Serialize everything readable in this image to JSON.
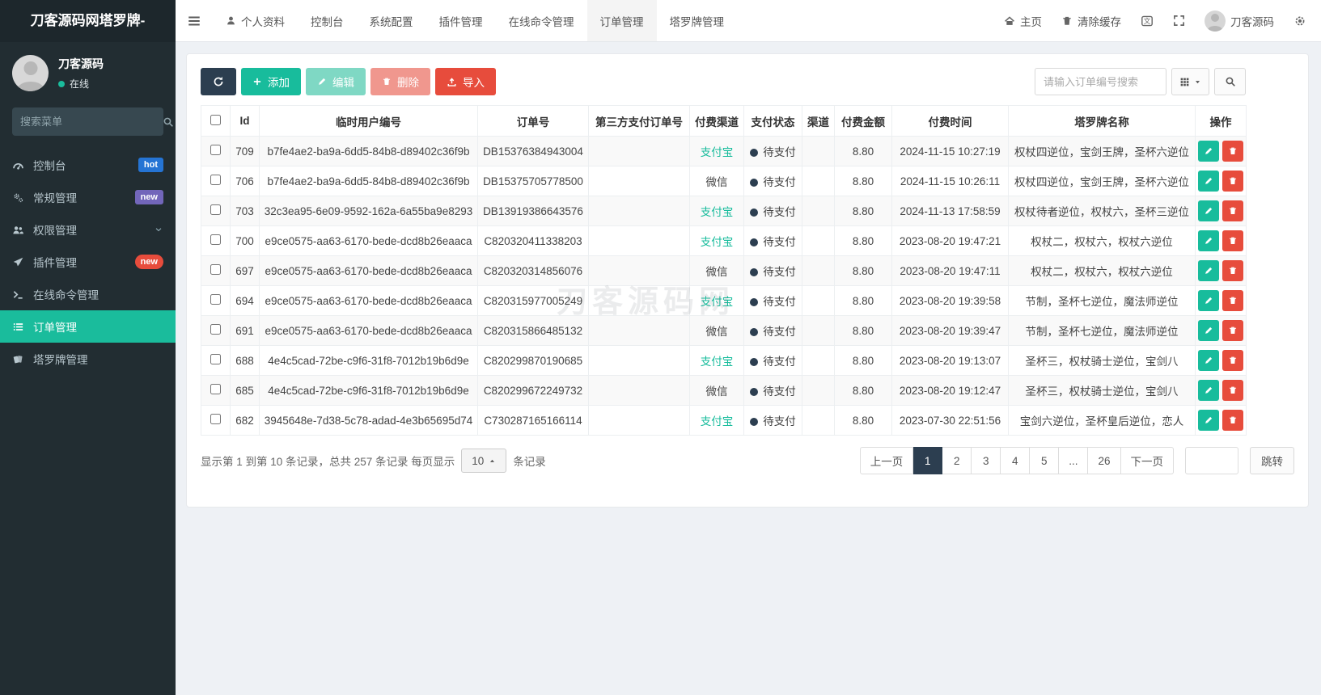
{
  "colors": {
    "accent_teal": "#1abc9c",
    "dark_navy": "#2c3e50",
    "danger_red": "#e74c3c",
    "badge_blue": "#2574d4",
    "badge_purple": "#7266ba",
    "sidebar_bg": "#222d32"
  },
  "watermark": "刀客源码网",
  "sidebar": {
    "brand": "刀客源码网塔罗牌-",
    "user": {
      "name": "刀客源码",
      "status": "在线"
    },
    "search_placeholder": "搜索菜单",
    "items": [
      {
        "key": "dashboard",
        "label": "控制台",
        "icon": "dashboard",
        "badge": "hot",
        "badge_color": "#2574d4",
        "badge_pill": false,
        "active": false,
        "chevron": false
      },
      {
        "key": "general",
        "label": "常规管理",
        "icon": "gears",
        "badge": "new",
        "badge_color": "#7266ba",
        "badge_pill": false,
        "active": false,
        "chevron": false
      },
      {
        "key": "auth",
        "label": "权限管理",
        "icon": "users",
        "badge": "",
        "active": false,
        "chevron": true
      },
      {
        "key": "addon",
        "label": "插件管理",
        "icon": "rocket",
        "badge": "new",
        "badge_color": "#e74c3c",
        "badge_pill": true,
        "active": false,
        "chevron": false
      },
      {
        "key": "command",
        "label": "在线命令管理",
        "icon": "terminal",
        "badge": "",
        "active": false,
        "chevron": false
      },
      {
        "key": "order",
        "label": "订单管理",
        "icon": "list",
        "badge": "",
        "active": true,
        "chevron": false
      },
      {
        "key": "tarot",
        "label": "塔罗牌管理",
        "icon": "cards",
        "badge": "",
        "active": false,
        "chevron": false
      }
    ]
  },
  "topbar": {
    "tabs": [
      {
        "key": "profile",
        "label": "个人资料",
        "icon": "user",
        "active": false
      },
      {
        "key": "dashboard",
        "label": "控制台",
        "icon": "",
        "active": false
      },
      {
        "key": "config",
        "label": "系统配置",
        "icon": "",
        "active": false
      },
      {
        "key": "addon",
        "label": "插件管理",
        "icon": "",
        "active": false
      },
      {
        "key": "command",
        "label": "在线命令管理",
        "icon": "",
        "active": false
      },
      {
        "key": "order",
        "label": "订单管理",
        "icon": "",
        "active": true
      },
      {
        "key": "tarot",
        "label": "塔罗牌管理",
        "icon": "",
        "active": false
      }
    ],
    "right": {
      "home": "主页",
      "clear_cache": "清除缓存",
      "username": "刀客源码"
    }
  },
  "toolbar": {
    "add": "添加",
    "edit": "编辑",
    "delete": "删除",
    "import": "导入",
    "search_placeholder": "请输入订单编号搜索"
  },
  "table": {
    "columns": [
      "Id",
      "临时用户编号",
      "订单号",
      "第三方支付订单号",
      "付费渠道",
      "支付状态",
      "渠道",
      "付费金额",
      "付费时间",
      "塔罗牌名称",
      "操作"
    ],
    "rows": [
      {
        "id": "709",
        "user_no": "b7fe4ae2-ba9a-6dd5-84b8-d89402c36f9b",
        "order_no": "DB15376384943004",
        "third_no": "",
        "channel": "支付宝",
        "channel_class": "alipay",
        "status": "待支付",
        "qudao": "",
        "amount": "8.80",
        "time": "2024-11-15 10:27:19",
        "tarot": "权杖四逆位，宝剑王牌，圣杯六逆位"
      },
      {
        "id": "706",
        "user_no": "b7fe4ae2-ba9a-6dd5-84b8-d89402c36f9b",
        "order_no": "DB15375705778500",
        "third_no": "",
        "channel": "微信",
        "channel_class": "wechat",
        "status": "待支付",
        "qudao": "",
        "amount": "8.80",
        "time": "2024-11-15 10:26:11",
        "tarot": "权杖四逆位，宝剑王牌，圣杯六逆位"
      },
      {
        "id": "703",
        "user_no": "32c3ea95-6e09-9592-162a-6a55ba9e8293",
        "order_no": "DB13919386643576",
        "third_no": "",
        "channel": "支付宝",
        "channel_class": "alipay",
        "status": "待支付",
        "qudao": "",
        "amount": "8.80",
        "time": "2024-11-13 17:58:59",
        "tarot": "权杖待者逆位，权杖六，圣杯三逆位"
      },
      {
        "id": "700",
        "user_no": "e9ce0575-aa63-6170-bede-dcd8b26eaaca",
        "order_no": "C820320411338203",
        "third_no": "",
        "channel": "支付宝",
        "channel_class": "alipay",
        "status": "待支付",
        "qudao": "",
        "amount": "8.80",
        "time": "2023-08-20 19:47:21",
        "tarot": "权杖二，权杖六，权杖六逆位"
      },
      {
        "id": "697",
        "user_no": "e9ce0575-aa63-6170-bede-dcd8b26eaaca",
        "order_no": "C820320314856076",
        "third_no": "",
        "channel": "微信",
        "channel_class": "wechat",
        "status": "待支付",
        "qudao": "",
        "amount": "8.80",
        "time": "2023-08-20 19:47:11",
        "tarot": "权杖二，权杖六，权杖六逆位"
      },
      {
        "id": "694",
        "user_no": "e9ce0575-aa63-6170-bede-dcd8b26eaaca",
        "order_no": "C820315977005249",
        "third_no": "",
        "channel": "支付宝",
        "channel_class": "alipay",
        "status": "待支付",
        "qudao": "",
        "amount": "8.80",
        "time": "2023-08-20 19:39:58",
        "tarot": "节制，圣杯七逆位，魔法师逆位"
      },
      {
        "id": "691",
        "user_no": "e9ce0575-aa63-6170-bede-dcd8b26eaaca",
        "order_no": "C820315866485132",
        "third_no": "",
        "channel": "微信",
        "channel_class": "wechat",
        "status": "待支付",
        "qudao": "",
        "amount": "8.80",
        "time": "2023-08-20 19:39:47",
        "tarot": "节制，圣杯七逆位，魔法师逆位"
      },
      {
        "id": "688",
        "user_no": "4e4c5cad-72be-c9f6-31f8-7012b19b6d9e",
        "order_no": "C820299870190685",
        "third_no": "",
        "channel": "支付宝",
        "channel_class": "alipay",
        "status": "待支付",
        "qudao": "",
        "amount": "8.80",
        "time": "2023-08-20 19:13:07",
        "tarot": "圣杯三，权杖骑士逆位，宝剑八"
      },
      {
        "id": "685",
        "user_no": "4e4c5cad-72be-c9f6-31f8-7012b19b6d9e",
        "order_no": "C820299672249732",
        "third_no": "",
        "channel": "微信",
        "channel_class": "wechat",
        "status": "待支付",
        "qudao": "",
        "amount": "8.80",
        "time": "2023-08-20 19:12:47",
        "tarot": "圣杯三，权杖骑士逆位，宝剑八"
      },
      {
        "id": "682",
        "user_no": "3945648e-7d38-5c78-adad-4e3b65695d74",
        "order_no": "C730287165166114",
        "third_no": "",
        "channel": "支付宝",
        "channel_class": "alipay",
        "status": "待支付",
        "qudao": "",
        "amount": "8.80",
        "time": "2023-07-30 22:51:56",
        "tarot": "宝剑六逆位，圣杯皇后逆位，恋人"
      }
    ]
  },
  "pagination": {
    "summary_prefix": "显示第 1 到第 10 条记录，总共 257 条记录 每页显示",
    "page_size": "10",
    "summary_suffix": "条记录",
    "prev": "上一页",
    "next": "下一页",
    "pages": [
      "1",
      "2",
      "3",
      "4",
      "5",
      "...",
      "26"
    ],
    "active_page": "1",
    "jump": "跳转",
    "jump_value": ""
  }
}
